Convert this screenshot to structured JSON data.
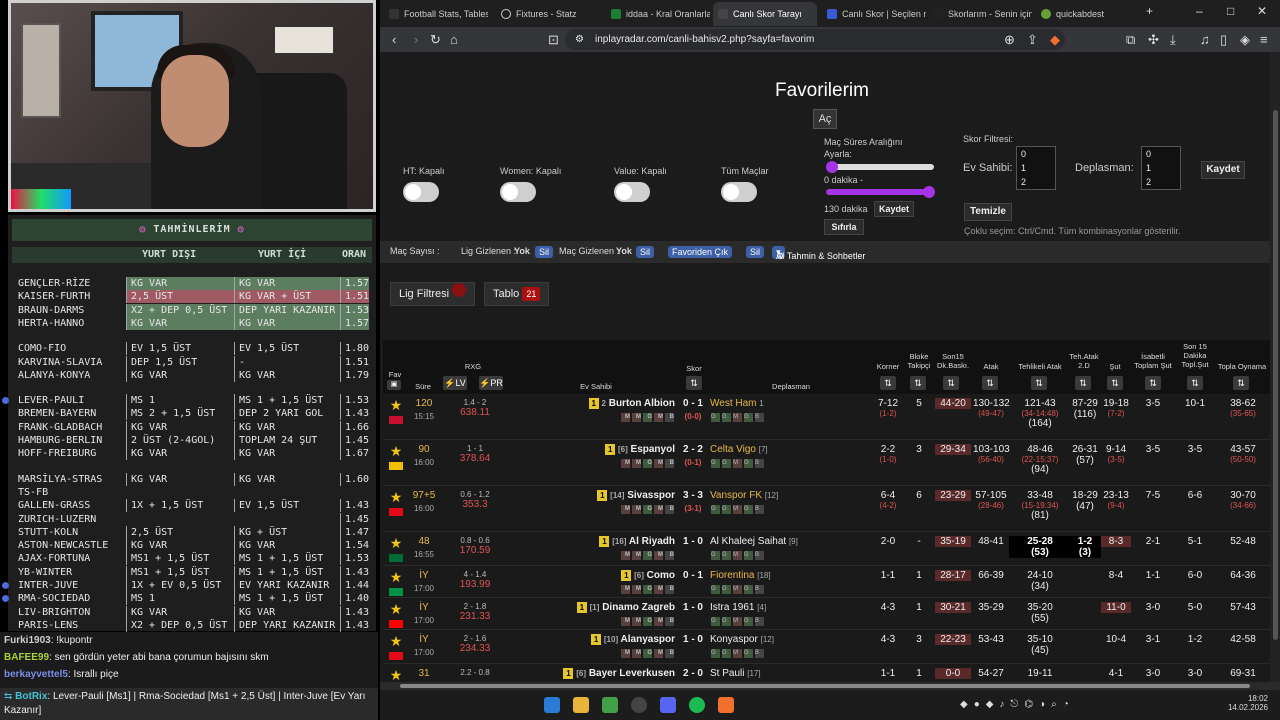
{
  "overlay": {
    "title": "TAHMİNLERİM",
    "col_away": "YURT DIŞI",
    "col_home": "YURT İÇİ",
    "col_odds": "ORAN",
    "rows": [
      {
        "m": "GENÇLER-RİZE",
        "a": "KG VAR",
        "b": "KG VAR",
        "o": "1.57",
        "s": "g"
      },
      {
        "m": "KAISER-FURTH",
        "a": "2,5 ÜST",
        "b": "KG VAR + ÜST",
        "o": "1.51",
        "s": "r"
      },
      {
        "m": "BRAUN-DARMS",
        "a": "X2 + DEP 0,5 ÜST",
        "b": "DEP YARI KAZANIR",
        "o": "1.53",
        "s": "g"
      },
      {
        "m": "HERTA-HANNO",
        "a": "KG VAR",
        "b": "KG VAR",
        "o": "1.57",
        "s": "g"
      },
      {
        "m": "COMO-FIO",
        "a": "EV 1,5 ÜST",
        "b": "EV 1,5 ÜST",
        "o": "1.80",
        "s": ""
      },
      {
        "m": "KARVINA-SLAVIA",
        "a": "DEP 1,5 ÜST",
        "b": "-",
        "o": "1.51",
        "s": ""
      },
      {
        "m": "ALANYA-KONYA",
        "a": "KG VAR",
        "b": "KG VAR",
        "o": "1.79",
        "s": ""
      },
      {
        "m": "LEVER-PAULI",
        "a": "MS 1",
        "b": "MS 1 + 1,5 ÜST",
        "o": "1.53",
        "s": "",
        "d": true
      },
      {
        "m": "BREMEN-BAYERN",
        "a": "MS 2 + 1,5 ÜST",
        "b": "DEP 2 YARI GOL",
        "o": "1.43",
        "s": ""
      },
      {
        "m": "FRANK-GLADBACH",
        "a": "KG VAR",
        "b": "KG VAR",
        "o": "1.66",
        "s": ""
      },
      {
        "m": "HAMBURG-BERLIN",
        "a": "2 ÜST (2-4GOL)",
        "b": "TOPLAM 24 ŞUT",
        "o": "1.45",
        "s": ""
      },
      {
        "m": "HOFF-FREIBURG",
        "a": "KG VAR",
        "b": "KG VAR",
        "o": "1.67",
        "s": ""
      },
      {
        "m": "MARSİLYA-STRAS",
        "a": "KG VAR",
        "b": "KG VAR",
        "o": "1.60",
        "s": ""
      },
      {
        "m": "TS-FB",
        "a": "",
        "b": "",
        "o": "",
        "s": ""
      },
      {
        "m": "GALLEN-GRASS",
        "a": "1X + 1,5 ÜST",
        "b": "EV 1,5 ÜST",
        "o": "1.43",
        "s": ""
      },
      {
        "m": "ZURICH-LUZERN",
        "a": "",
        "b": "",
        "o": "1.45",
        "s": ""
      },
      {
        "m": "STUTT-KOLN",
        "a": "2,5 ÜST",
        "b": "KG + ÜST",
        "o": "1.47",
        "s": ""
      },
      {
        "m": "ASTON-NEWCASTLE",
        "a": "KG VAR",
        "b": "KG VAR",
        "o": "1.54",
        "s": ""
      },
      {
        "m": "AJAX-FORTUNA",
        "a": "MS1 + 1,5 ÜST",
        "b": "MS 1 + 1,5 ÜST",
        "o": "1.53",
        "s": ""
      },
      {
        "m": "YB-WINTER",
        "a": "MS1 + 1,5 ÜST",
        "b": "MS 1 + 1,5 ÜST",
        "o": "1.43",
        "s": ""
      },
      {
        "m": "INTER-JUVE",
        "a": "1X + EV 0,5 ÜST",
        "b": "EV YARI KAZANIR",
        "o": "1.44",
        "s": "",
        "d": true
      },
      {
        "m": "RMA-SOCIEDAD",
        "a": "MS 1",
        "b": "MS 1 + 1,5 ÜST",
        "o": "1.40",
        "s": "",
        "d": true
      },
      {
        "m": "LIV-BRIGHTON",
        "a": "KG VAR",
        "b": "KG VAR",
        "o": "1.43",
        "s": ""
      },
      {
        "m": "PARIS-LENS",
        "a": "X2 + DEP 0,5 ÜST",
        "b": "DEP YARI KAZANIR",
        "o": "1.43",
        "s": ""
      }
    ]
  },
  "chat": [
    {
      "user": "Furki1903",
      "msg": ": !kupontr"
    },
    {
      "user": "BAFEE99",
      "msg": ": sen gördün yeter abi bana çorumun bajısını skm"
    },
    {
      "user": "berkayvettel5",
      "msg": ": Israllı piçe"
    }
  ],
  "chatbot": {
    "user": "BotRix",
    "msg": ": Lever-Pauli [Ms1] | Rma-Sociedad [Ms1 + 2,5 Üst] | Inter-Juve [Ev Yarı Kazanır]"
  },
  "browser": {
    "tabs": [
      "Football Stats, Tables",
      "Fixtures - Statz",
      "iddaa - Kral Oranlarla",
      "Canlı Skor Tarayı",
      "Canlı Skor | Seçilen m",
      "Skorlarım - Senin için",
      "quickabdest"
    ],
    "url": "inplayradar.com/canli-bahisv2.php?sayfa=favorim"
  },
  "page": {
    "title": "Favorilerim",
    "ac": "Aç",
    "ht": "HT: Kapalı",
    "women": "Women: Kapalı",
    "value": "Value: Kapalı",
    "all": "Tüm Maçlar",
    "range_title": "Maç Süres Aralığını Ayarla:",
    "range_min": "0 dakika -",
    "range_max": "130 dakika",
    "kaydet": "Kaydet",
    "sifirla": "Sıfırla",
    "score_filter": "Skor Filtresi:",
    "home_label": "Ev Sahibi:",
    "away_label": "Deplasman:",
    "options": [
      "0",
      "1",
      "2"
    ],
    "temizle": "Temizle",
    "multi_note": "Çoklu seçim: Ctrl/Cmd. Tüm kombinasyonlar gösterilir.",
    "bar_count": "Maç Sayısı :",
    "bar_league": "Lig Gizlenen :",
    "bar_match": "Maç Gizlenen :",
    "yok": "Yok",
    "sil": "Sil",
    "fav_out": "Favoriden Çık",
    "ai": "AI Tahmin & Sohbetler",
    "lig_filter": "Lig Filtresi",
    "tablo": "Tablo",
    "tablo_count": "21"
  },
  "table": {
    "headers": {
      "fav": "Fav",
      "sure": "Süre",
      "rxg": "RXG",
      "lv": "LV",
      "pr": "PR",
      "home": "Ev Sahibi",
      "skor": "Skor",
      "away": "Deplasman",
      "korner": "Korner",
      "bloke": "Bloke Takipçi",
      "son15": "Son15 Dk.Baskı.",
      "atak": "Atak",
      "tehlikeli": "Tehlikeli Atak",
      "teh_atak": "Teh.Atak 2.D",
      "sut": "Şut",
      "isabetli": "İsabetli Toplam Şut",
      "son15sut": "Son 15 Dakika Topl.Şut",
      "topla": "Topla Oynama"
    },
    "rows": [
      {
        "min": "120",
        "time": "15:15",
        "rxg": "1.4 - 2",
        "rxg2": "638.11",
        "home": "Burton Albion",
        "hr": "2",
        "score": "0 - 1",
        "score2": "(0-0)",
        "away": "West Ham",
        "ac": "1",
        "ay": "1",
        "korner": "7-12",
        "korner2": "(1-2)",
        "bloke": "5",
        "son15": "44-20",
        "atak": "130-132",
        "atak2": "(49-47)",
        "teh": "121-43",
        "teh2": "(34-14:48)",
        "teh3": "(164)",
        "teh2d": "87-29",
        "teh2d2": "(116)",
        "sut": "19-18",
        "sut2": "(7-2)",
        "isab": "3-5",
        "s15": "10-1",
        "top": "38-62",
        "top2": "(35-65)"
      },
      {
        "min": "90",
        "time": "16:00",
        "rxg": "1 - 1",
        "rxg2": "378.64",
        "home": "Espanyol",
        "hr": "[6]",
        "score": "2 - 2",
        "score2": "(0-1)",
        "away": "Celta Vigo",
        "ac": "[7]",
        "korner": "2-2",
        "korner2": "(1-0)",
        "bloke": "3",
        "son15": "29-34",
        "atak": "103-103",
        "atak2": "(56-40)",
        "teh": "48-46",
        "teh2": "(22-15:37)",
        "teh3": "(94)",
        "teh2d": "26-31",
        "teh2d2": "(57)",
        "sut": "9-14",
        "sut2": "(3-5)",
        "isab": "3-5",
        "s15": "3-5",
        "top": "43-57",
        "top2": "(50-50)"
      },
      {
        "min": "97+5",
        "time": "16:00",
        "rxg": "0.6 - 1.2",
        "rxg2": "353.3",
        "home": "Sivasspor",
        "hr": "[14]",
        "score": "3 - 3",
        "score2": "(3-1)",
        "away": "Vanspor FK",
        "ac": "[12]",
        "korner": "6-4",
        "korner2": "(4-2)",
        "bloke": "6",
        "son15": "23-29",
        "atak": "57-105",
        "atak2": "(28-46)",
        "teh": "33-48",
        "teh2": "(15-19:34)",
        "teh3": "(81)",
        "teh2d": "18-29",
        "teh2d2": "(47)",
        "sut": "23-13",
        "sut2": "(9-4)",
        "isab": "7-5",
        "s15": "6-6",
        "top": "30-70",
        "top2": "(34-66)"
      },
      {
        "min": "48",
        "time": "16:55",
        "rxg": "0.8 - 0.6",
        "rxg2": "170.59",
        "home": "Al Riyadh",
        "hr": "[16]",
        "score": "1 - 0",
        "score2": "",
        "away": "Al Khaleej Saihat",
        "ac": "[9]",
        "korner": "2-0",
        "korner2": "",
        "bloke": "-",
        "son15": "35-19",
        "atak": "48-41",
        "atak2": "",
        "teh": "25-28",
        "teh2": "",
        "teh3": "(53)",
        "teh2d": "1-2",
        "teh2d2": "(3)",
        "sut": "8-3",
        "sut2": "",
        "isab": "2-1",
        "s15": "5-1",
        "top": "52-48",
        "top2": ""
      },
      {
        "min": "İY",
        "time": "17:00",
        "rxg": "4 - 1.4",
        "rxg2": "193.99",
        "home": "Como",
        "hr": "[6]",
        "score": "0 - 1",
        "score2": "",
        "away": "Fiorentina",
        "ac": "[18]",
        "korner": "1-1",
        "korner2": "",
        "bloke": "1",
        "son15": "28-17",
        "atak": "66-39",
        "atak2": "",
        "teh": "24-10",
        "teh2": "",
        "teh3": "(34)",
        "teh2d": "",
        "teh2d2": "",
        "sut": "8-4",
        "sut2": "",
        "isab": "1-1",
        "s15": "6-0",
        "top": "64-36",
        "top2": ""
      },
      {
        "min": "İY",
        "time": "17:00",
        "rxg": "2 - 1.8",
        "rxg2": "231.33",
        "home": "Dinamo Zagreb",
        "hr": "[1]",
        "score": "1 - 0",
        "score2": "",
        "away": "Istra 1961",
        "ac": "[4]",
        "korner": "4-3",
        "korner2": "",
        "bloke": "1",
        "son15": "30-21",
        "atak": "35-29",
        "atak2": "",
        "teh": "35-20",
        "teh2": "",
        "teh3": "(55)",
        "teh2d": "",
        "teh2d2": "",
        "sut": "11-0",
        "sut2": "",
        "isab": "3-0",
        "s15": "5-0",
        "top": "57-43",
        "top2": ""
      },
      {
        "min": "İY",
        "time": "17:00",
        "rxg": "2 - 1.6",
        "rxg2": "234.33",
        "home": "Alanyaspor",
        "hr": "[10]",
        "score": "1 - 0",
        "score2": "",
        "away": "Konyaspor",
        "ac": "[12]",
        "korner": "4-3",
        "korner2": "",
        "bloke": "3",
        "son15": "22-23",
        "atak": "53-43",
        "atak2": "",
        "teh": "35-10",
        "teh2": "",
        "teh3": "(45)",
        "teh2d": "",
        "teh2d2": "",
        "sut": "10-4",
        "sut2": "",
        "isab": "3-1",
        "s15": "1-2",
        "top": "42-58",
        "top2": ""
      },
      {
        "min": "31",
        "time": "",
        "rxg": "2.2 - 0.8",
        "rxg2": "",
        "home": "Bayer Leverkusen",
        "hr": "[6]",
        "score": "2 - 0",
        "score2": "",
        "away": "St Pauli",
        "ac": "[17]",
        "korner": "1-1",
        "korner2": "",
        "bloke": "1",
        "son15": "0-0",
        "atak": "54-27",
        "atak2": "",
        "teh": "19-11",
        "teh2": "",
        "teh3": "",
        "teh2d": "",
        "teh2d2": "",
        "sut": "4-1",
        "sut2": "",
        "isab": "3-0",
        "s15": "3-0",
        "top": "69-31",
        "top2": ""
      }
    ]
  },
  "taskbar": {
    "time": "18:02",
    "date": "14.02.2026"
  },
  "colors": {
    "accent": "#a533e8",
    "green": "#5d7d60",
    "red": "#a05a63",
    "pill": "#3c5fa5"
  }
}
